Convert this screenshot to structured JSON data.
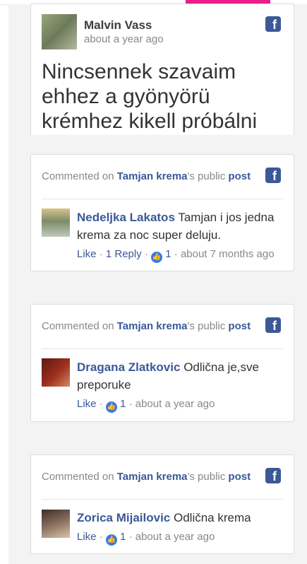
{
  "post": {
    "author": "Malvin Vass",
    "time": "about a year ago",
    "text": "Nincsennek szavaim ehhez a gyönyörü krémhez kikell próbálni",
    "fb_icon": "facebook-icon"
  },
  "comments": [
    {
      "header": {
        "prefix": "Commented on ",
        "page": "Tamjan krema",
        "mid": "'s public ",
        "post_label": "post"
      },
      "author": "Nedeljka Lakatos",
      "text": "Tamjan i jos jedna krema za noc super deluju.",
      "like": "Like",
      "sep": " · ",
      "reply": "1 Reply",
      "likes": "1",
      "time": "about 7 months ago"
    },
    {
      "header": {
        "prefix": "Commented on ",
        "page": "Tamjan krema",
        "mid": "'s public ",
        "post_label": "post"
      },
      "author": "Dragana Zlatkovic",
      "text": "Odlična je,sve preporuke",
      "like": "Like",
      "sep": " · ",
      "likes": "1",
      "time": "about a year ago"
    },
    {
      "header": {
        "prefix": "Commented on ",
        "page": "Tamjan krema",
        "mid": "'s public ",
        "post_label": "post"
      },
      "author": "Zorica Mijailovic",
      "text": "Odlična krema",
      "like": "Like",
      "sep": " · ",
      "likes": "1",
      "time": "about a year ago"
    }
  ],
  "colors": {
    "accent": "#e91e8c",
    "link": "#3b5998",
    "like_icon": "#3b78e7"
  }
}
